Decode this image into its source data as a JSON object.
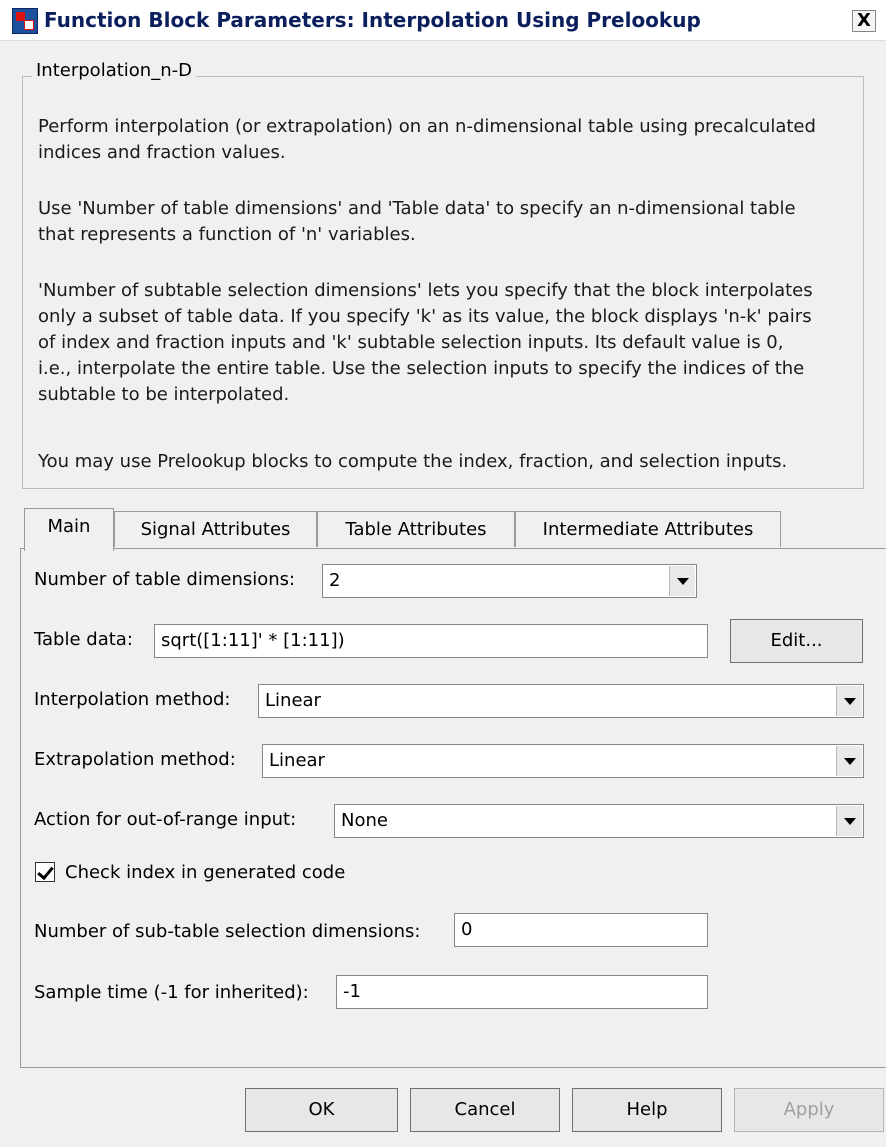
{
  "window": {
    "title": "Function Block Parameters: Interpolation Using Prelookup",
    "close_label": "X"
  },
  "group": {
    "legend": "Interpolation_n-D",
    "description": [
      [
        "Perform interpolation (or extrapolation) on an n-dimensional table using precalculated",
        "indices and fraction values."
      ],
      [
        "Use 'Number of table dimensions' and 'Table data' to specify an n-dimensional table",
        "that represents a function of 'n' variables."
      ],
      [
        "'Number of subtable selection dimensions' lets you specify that the block interpolates",
        "only a subset of table data. If you specify 'k' as its value, the block displays 'n-k' pairs",
        "of index and fraction inputs and 'k' subtable selection inputs. Its default value is 0,",
        "i.e., interpolate the entire table. Use the selection inputs to specify the indices of the",
        "subtable to be interpolated."
      ],
      [
        "You may use Prelookup blocks to compute the index, fraction, and selection inputs."
      ]
    ]
  },
  "tabs": [
    "Main",
    "Signal Attributes",
    "Table Attributes",
    "Intermediate Attributes"
  ],
  "main": {
    "num_dims": {
      "label": "Number of table dimensions:",
      "value": "2"
    },
    "table_data": {
      "label": "Table data:",
      "value": "sqrt([1:11]' * [1:11])",
      "edit_label": "Edit..."
    },
    "interp_method": {
      "label": "Interpolation method:",
      "value": "Linear"
    },
    "extrap_method": {
      "label": "Extrapolation method:",
      "value": "Linear"
    },
    "out_of_range": {
      "label": "Action for out-of-range input:",
      "value": "None"
    },
    "check_index": {
      "label": "Check index in generated code",
      "checked": true
    },
    "subtable_dims": {
      "label": "Number of sub-table selection dimensions:",
      "value": "0"
    },
    "sample_time": {
      "label": "Sample time (-1 for inherited):",
      "value": "-1"
    }
  },
  "buttons": {
    "ok": "OK",
    "cancel": "Cancel",
    "help": "Help",
    "apply": "Apply"
  }
}
